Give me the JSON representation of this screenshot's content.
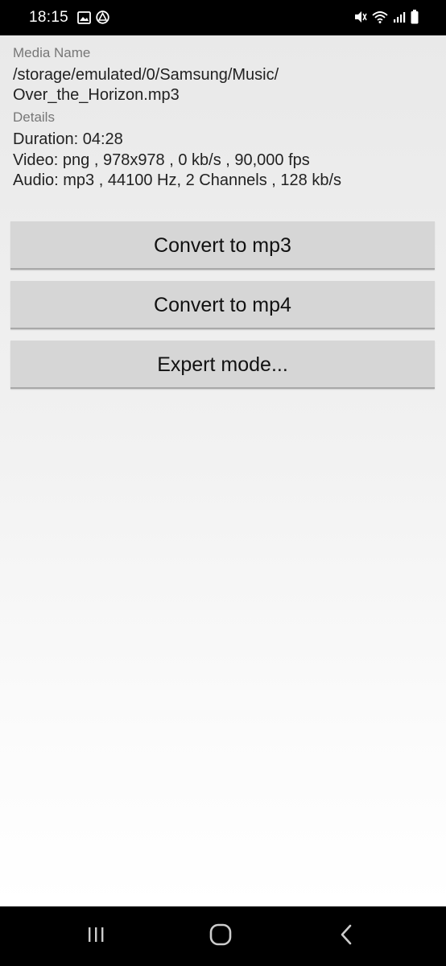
{
  "status_bar": {
    "time": "18:15",
    "icons": [
      "image-icon",
      "nearby-share-icon",
      "mute-icon",
      "wifi-icon",
      "signal-icon",
      "battery-icon"
    ]
  },
  "media": {
    "name_label": "Media Name",
    "path_line1": "/storage/emulated/0/Samsung/Music/",
    "path_line2": "Over_the_Horizon.mp3",
    "details_label": "Details",
    "duration": "Duration: 04:28",
    "video": "Video: png , 978x978 , 0 kb/s , 90,000 fps",
    "audio": "Audio: mp3 , 44100 Hz, 2 Channels , 128 kb/s"
  },
  "actions": {
    "convert_mp3": "Convert to mp3",
    "convert_mp4": "Convert to mp4",
    "expert_mode": "Expert mode..."
  },
  "nav_bar": {
    "icons": [
      "recents-icon",
      "home-icon",
      "back-icon"
    ]
  }
}
